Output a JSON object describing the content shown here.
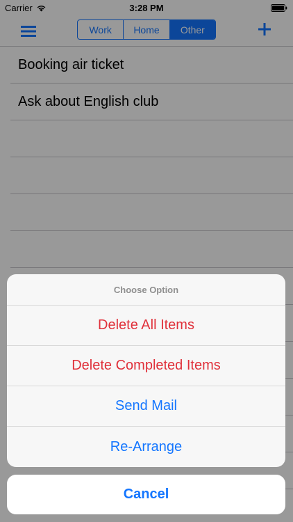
{
  "status_bar": {
    "carrier": "Carrier",
    "time": "3:28 PM",
    "icons": [
      "wifi-icon",
      "battery-icon"
    ]
  },
  "nav": {
    "segments": [
      {
        "label": "Work",
        "selected": false
      },
      {
        "label": "Home",
        "selected": false
      },
      {
        "label": "Other",
        "selected": true
      }
    ],
    "left_icon": "menu-icon",
    "right_icon": "add-icon",
    "accent_color": "#1476ff"
  },
  "list": {
    "items": [
      {
        "text": "Booking air ticket"
      },
      {
        "text": "Ask about English club"
      }
    ]
  },
  "action_sheet": {
    "title": "Choose Option",
    "options": [
      {
        "label": "Delete All Items",
        "style": "destructive"
      },
      {
        "label": "Delete Completed Items",
        "style": "destructive"
      },
      {
        "label": "Send Mail",
        "style": "default"
      },
      {
        "label": "Re-Arrange",
        "style": "default"
      }
    ],
    "cancel_label": "Cancel",
    "destructive_color": "#e0303a"
  }
}
